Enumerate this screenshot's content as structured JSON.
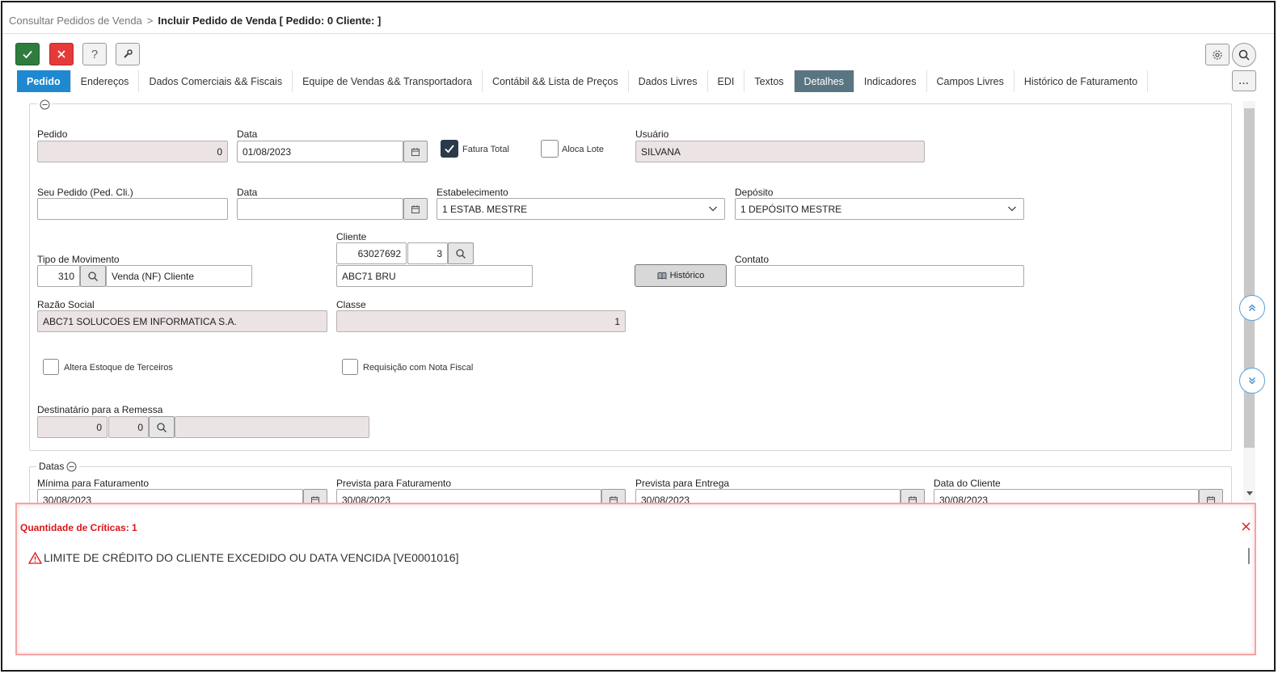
{
  "breadcrumb": {
    "parent": "Consultar Pedidos de Venda",
    "separator": ">",
    "current": "Incluir Pedido de Venda [ Pedido: 0 Cliente: ]"
  },
  "toolbar": {
    "confirm_icon": "check-icon",
    "cancel_icon": "close-icon",
    "help_icon": "help-icon",
    "tools_icon": "wrench-icon",
    "settings_icon": "gear-icon",
    "search_icon": "search-icon",
    "more_label": "...",
    "colors": {
      "confirm": "#2f7d3e",
      "cancel": "#e63a3a"
    }
  },
  "tabs": [
    {
      "label": "Pedido",
      "state": "active"
    },
    {
      "label": "Endereços"
    },
    {
      "label": "Dados Comerciais && Fiscais"
    },
    {
      "label": "Equipe de Vendas && Transportadora"
    },
    {
      "label": "Contábil && Lista de Preços"
    },
    {
      "label": "Dados Livres"
    },
    {
      "label": "EDI"
    },
    {
      "label": "Textos"
    },
    {
      "label": "Detalhes",
      "state": "highlighted"
    },
    {
      "label": "Indicadores"
    },
    {
      "label": "Campos Livres"
    },
    {
      "label": "Histórico de Faturamento"
    }
  ],
  "form": {
    "pedido": {
      "label": "Pedido",
      "value": "0"
    },
    "data1": {
      "label": "Data",
      "value": "01/08/2023"
    },
    "fatura_total": {
      "label": "Fatura Total",
      "checked": true
    },
    "aloca_lote": {
      "label": "Aloca Lote",
      "checked": false
    },
    "usuario": {
      "label": "Usuário",
      "value": "SILVANA"
    },
    "seu_pedido": {
      "label": "Seu Pedido (Ped. Cli.)",
      "value": ""
    },
    "data2": {
      "label": "Data",
      "value": ""
    },
    "estabelecimento": {
      "label": "Estabelecimento",
      "value": "1 ESTAB. MESTRE"
    },
    "deposito": {
      "label": "Depósito",
      "value": "1 DEPÓSITO MESTRE"
    },
    "tipo_movimento": {
      "label": "Tipo de Movimento",
      "code": "310",
      "description": "Venda (NF) Cliente"
    },
    "cliente": {
      "label": "Cliente",
      "code": "63027692",
      "seq": "3",
      "name": "ABC71 BRU"
    },
    "historico_button": "Histórico",
    "contato": {
      "label": "Contato",
      "value": ""
    },
    "razao_social": {
      "label": "Razão Social",
      "value": "ABC71 SOLUCOES EM INFORMATICA S.A."
    },
    "classe": {
      "label": "Classe",
      "value": "1"
    },
    "altera_estoque": {
      "label": "Altera Estoque de Terceiros",
      "checked": false
    },
    "requisicao_nf": {
      "label": "Requisição com Nota Fiscal",
      "checked": false
    },
    "destinatario": {
      "label": "Destinatário para a Remessa",
      "code1": "0",
      "code2": "0",
      "name": ""
    }
  },
  "datas": {
    "legend": "Datas",
    "minima": {
      "label": "Mínima para Faturamento",
      "value": "30/08/2023"
    },
    "prevista_fat": {
      "label": "Prevista para Faturamento",
      "value": "30/08/2023"
    },
    "prevista_ent": {
      "label": "Prevista para Entrega",
      "value": "30/08/2023"
    },
    "data_cliente": {
      "label": "Data do Cliente",
      "value": "30/08/2023"
    }
  },
  "criticas": {
    "title": "Quantidade de Críticas: 1",
    "message": "LIMITE DE CRÉDITO DO CLIENTE EXCEDIDO OU DATA VENCIDA [VE0001016]",
    "color": "#d9161b"
  }
}
